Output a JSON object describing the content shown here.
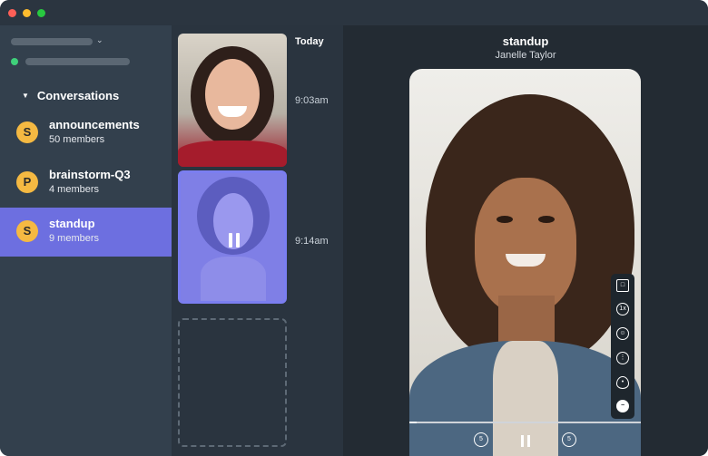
{
  "window": {
    "traffic_lights": [
      "#ff5f57",
      "#febc2e",
      "#28c840"
    ]
  },
  "sidebar": {
    "section_title": "Conversations",
    "conversations": [
      {
        "initial": "S",
        "name": "announcements",
        "members": "50 members",
        "active": false
      },
      {
        "initial": "P",
        "name": "brainstorm-Q3",
        "members": "4 members",
        "active": false
      },
      {
        "initial": "S",
        "name": "standup",
        "members": "9 members",
        "active": true
      }
    ],
    "accent_color": "#6d6fe0",
    "avatar_color": "#f5b942",
    "status_color": "#3fd07a"
  },
  "timeline": {
    "day_label": "Today",
    "entries": [
      {
        "time": "9:03am",
        "state": "thumbnail"
      },
      {
        "time": "9:14am",
        "state": "playing"
      },
      {
        "time": "",
        "state": "empty-slot"
      }
    ]
  },
  "player": {
    "title": "standup",
    "author": "Janelle Taylor",
    "progress": 0.03,
    "side_controls": [
      "reply-icon",
      "speed-icon",
      "reaction-icon",
      "more-icon",
      "eye-icon",
      "minus-icon"
    ],
    "speed_label": "1x",
    "skip_back_label": "5",
    "skip_forward_label": "5"
  }
}
